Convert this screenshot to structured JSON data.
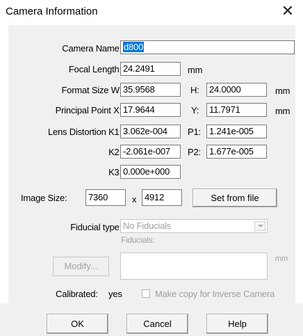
{
  "window": {
    "title": "Camera Information",
    "close_glyph": "✕"
  },
  "camera_name": {
    "label": "Camera Name:",
    "value": "d800"
  },
  "focal_length": {
    "label": "Focal Length:",
    "value": "24.2491",
    "unit": "mm"
  },
  "format_size": {
    "label": "Format Size  W:",
    "w_value": "35.9568",
    "h_label": "H:",
    "h_value": "24.0000",
    "unit": "mm"
  },
  "principal_point": {
    "label": "Principal Point  X:",
    "x_value": "17.9644",
    "y_label": "Y:",
    "y_value": "11.7971",
    "unit": "mm"
  },
  "lens_distortion": {
    "label": "Lens Distortion  K1:",
    "k1_value": "3.062e-004",
    "p1_label": "P1:",
    "p1_value": "1.241e-005",
    "k2_label": "K2:",
    "k2_value": "-2.061e-007",
    "p2_label": "P2:",
    "p2_value": "1.677e-005",
    "k3_label": "K3:",
    "k3_value": "0.000e+000"
  },
  "image_size": {
    "label": "Image Size:",
    "width": "7360",
    "separator": "x",
    "height": "4912",
    "set_button": "Set from file"
  },
  "fiducial": {
    "label": "Fiducial type:",
    "selected": "No Fiducials",
    "list_label": "Fiducials:",
    "unit": "mm",
    "modify_button": "Modify..."
  },
  "calibrated": {
    "label": "Calibrated:",
    "value": "yes",
    "copy_checkbox_label": "Make copy for Inverse Camera"
  },
  "buttons": {
    "ok": "OK",
    "cancel": "Cancel",
    "help": "Help"
  },
  "colors": {
    "panel_bg": "#f0f0f0",
    "selection": "#0078d7",
    "disabled_text": "#a0a0a0"
  }
}
